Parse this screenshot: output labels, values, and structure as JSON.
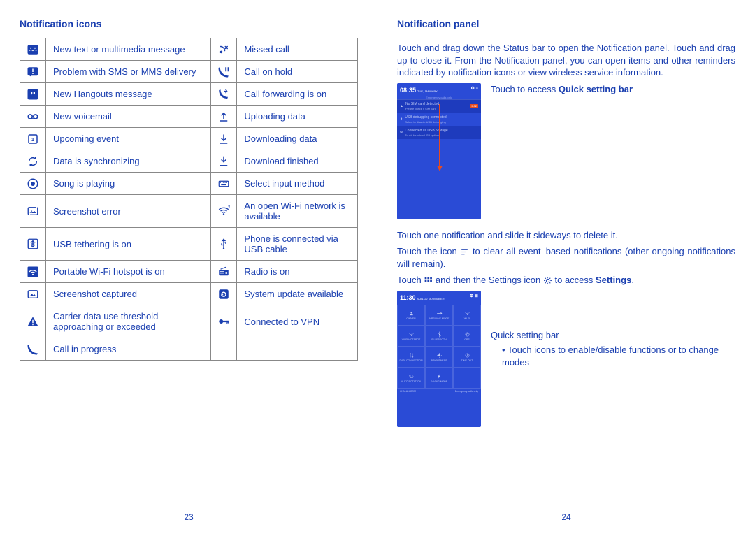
{
  "left": {
    "heading": "Notification icons",
    "rows": [
      [
        "New text or multimedia message",
        "Missed call"
      ],
      [
        "Problem with SMS or MMS delivery",
        "Call on hold"
      ],
      [
        "New Hangouts message",
        "Call forwarding is on"
      ],
      [
        "New voicemail",
        "Uploading data"
      ],
      [
        "Upcoming event",
        "Downloading data"
      ],
      [
        "Data is synchronizing",
        "Download finished"
      ],
      [
        "Song is playing",
        "Select input method"
      ],
      [
        "Screenshot error",
        "An open Wi-Fi network is available"
      ],
      [
        "USB tethering is on",
        "Phone is connected via USB cable"
      ],
      [
        "Portable Wi-Fi hotspot is on",
        "Radio is on"
      ],
      [
        "Screenshot captured",
        "System update available"
      ],
      [
        "Carrier data use threshold approaching or exceeded",
        "Connected to VPN"
      ],
      [
        "Call in progress",
        ""
      ]
    ],
    "pagenum": "23"
  },
  "right": {
    "heading": "Notification panel",
    "intro": "Touch and drag down the Status bar to open the Notification panel. Touch and drag up to close it. From the Notification panel, you can open items and other reminders indicated by notification icons or view wireless service information.",
    "touch_prefix": "Touch to access ",
    "touch_bold": "Quick setting bar",
    "tip_delete": "Touch one notification and slide it sideways to delete it.",
    "tip_clear_a": "Touch the icon ",
    "tip_clear_b": " to clear all event–based notifications (other ongoing notifications will remain).",
    "tip_settings_a": "Touch ",
    "tip_settings_b": " and then the Settings icon ",
    "tip_settings_c": " to access ",
    "settings_word": "Settings",
    "quick_label": "Quick setting bar",
    "quick_bullet": "Touch icons to enable/disable functions or to change modes",
    "shot1": {
      "time": "08:35",
      "date": "TUE, JANUARY",
      "emergency": "Emergency calls only",
      "nosim1": "No SIM card detected",
      "nosim2": "Please check if SIM card",
      "badge": "9:02",
      "usb1": "USB debugging connected",
      "usb2": "Select to disable USB debugging",
      "conn1": "Connected as USB Storage",
      "conn2": "Touch for other USB options"
    },
    "shot2": {
      "time": "11:30",
      "date": "SUN, 22 NOVEMBER",
      "tiles": [
        "OWNER",
        "AIRPLANE MODE",
        "WI-FI",
        "WI-FI HOTSPOT",
        "BLUETOOTH",
        "GPS",
        "DATA CONNECTION",
        "BRIGHTNESS",
        "TIME OUT",
        "AUTO ROTATION",
        "SAVING MODE",
        ""
      ],
      "foot_l": "CHN-UNICOM",
      "foot_r": "Emergency calls only"
    },
    "pagenum": "24"
  }
}
